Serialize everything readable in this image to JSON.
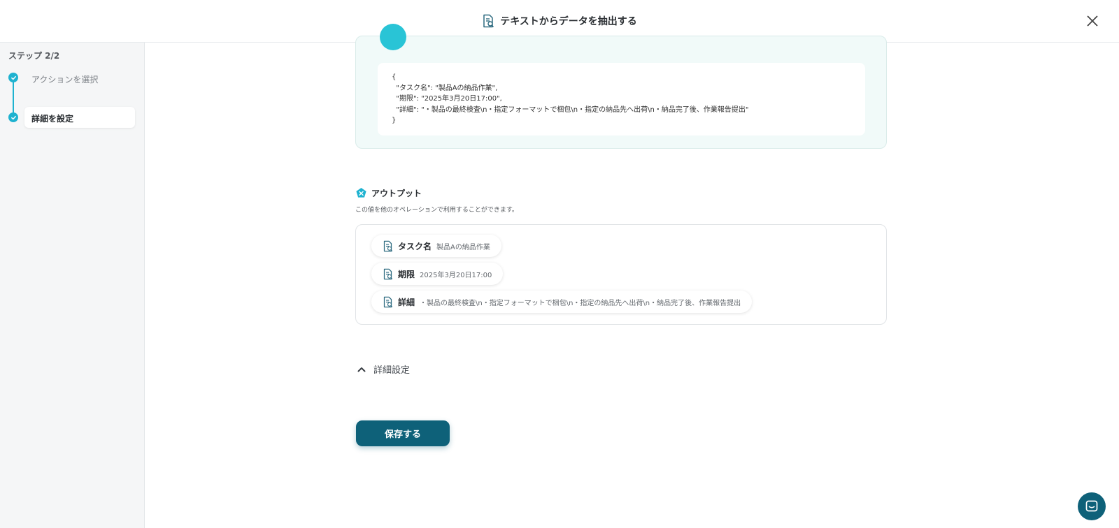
{
  "header": {
    "title": "テキストからデータを抽出する",
    "icon": "document-search-icon"
  },
  "sidebar": {
    "step_label": "ステップ 2/2",
    "steps": [
      {
        "label": "アクションを選択",
        "state": "done"
      },
      {
        "label": "詳細を設定",
        "state": "current"
      }
    ]
  },
  "code_card": {
    "lines": [
      "{",
      "  \"タスク名\": \"製品Aの納品作業\",",
      "  \"期限\": \"2025年3月20日17:00\",",
      "  \"詳細\": \"・製品の最終検査\\n・指定フォーマットで梱包\\n・指定の納品先へ出荷\\n・納品完了後、作業報告提出\"",
      "}"
    ]
  },
  "output": {
    "title": "アウトプット",
    "description": "この値を他のオペレーションで利用することができます。",
    "items": [
      {
        "name": "タスク名",
        "value": "製品Aの納品作業"
      },
      {
        "name": "期限",
        "value": "2025年3月20日17:00"
      },
      {
        "name": "詳細",
        "value": "・製品の最終検査\\n・指定フォーマットで梱包\\n・指定の納品先へ出荷\\n・納品完了後、作業報告提出"
      }
    ]
  },
  "advanced": {
    "label": "詳細設定"
  },
  "save_label": "保存する",
  "colors": {
    "accent": "#1eb2d0",
    "primary": "#0e6179",
    "card_bg": "#f1faf9"
  }
}
